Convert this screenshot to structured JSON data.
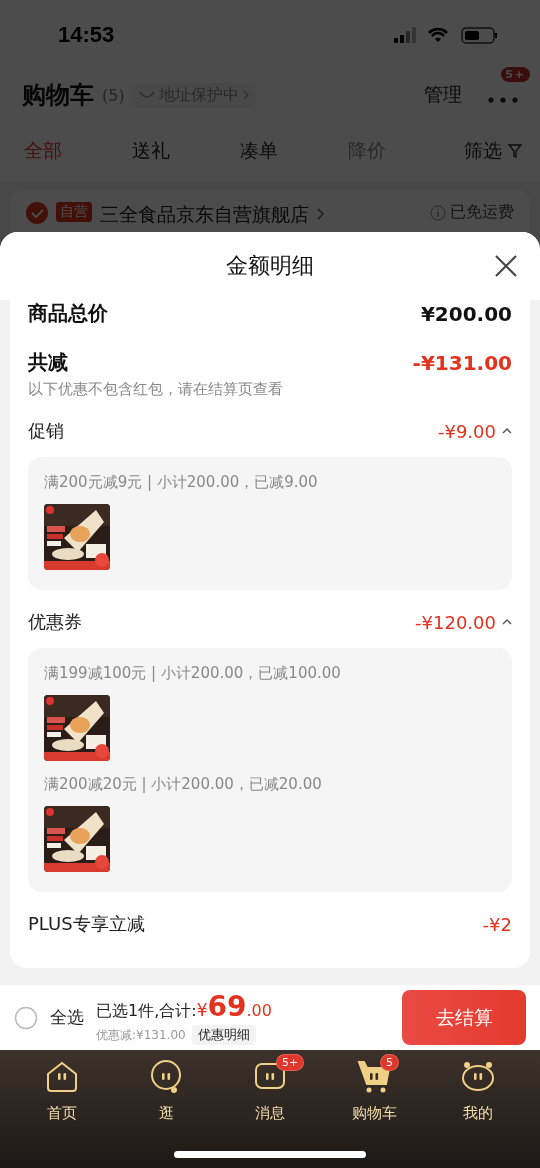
{
  "status_bar": {
    "time": "14:53"
  },
  "cart_page": {
    "title": "购物车",
    "count": "(5)",
    "address": "地址保护中",
    "manage": "管理",
    "more_badge": "5+",
    "tabs": [
      {
        "label": "全部",
        "selected": true,
        "disabled": false
      },
      {
        "label": "送礼",
        "selected": false,
        "disabled": false
      },
      {
        "label": "凑单",
        "selected": false,
        "disabled": false
      },
      {
        "label": "降价",
        "selected": false,
        "disabled": true
      }
    ],
    "filter": "筛选",
    "store": {
      "checked": true,
      "tag": "自营",
      "name": "三全食品京东自营旗舰店",
      "shipping": "已免运费"
    }
  },
  "sheet": {
    "title": "金额明细",
    "total": {
      "label": "商品总价",
      "amount": "¥200.00"
    },
    "reduction": {
      "label": "共减",
      "amount": "-¥131.00",
      "note": "以下优惠不包含红包，请在结算页查看"
    },
    "groups": [
      {
        "name": "促销",
        "amount": "-¥9.00",
        "expanded": true,
        "entries": [
          {
            "rule": "满200元减9元 | 小计200.00，已减9.00",
            "kind": "picture"
          }
        ]
      },
      {
        "name": "优惠券",
        "amount": "-¥120.00",
        "expanded": true,
        "entries": [
          {
            "rule": "满199减100元 | 小计200.00，已减100.00",
            "kind": "picture"
          },
          {
            "rule": "满200减20元 | 小计200.00，已减20.00",
            "kind": "picture"
          }
        ]
      },
      {
        "name": "PLUS专享立减",
        "amount": "-¥2"
      }
    ]
  },
  "bottom_bar": {
    "select_all": {
      "label": "全选",
      "checked": false
    },
    "summary": "已选1件,合计:",
    "currency": "¥",
    "price_int": "69",
    "price_dec": ".00",
    "discount": "优惠减:¥131.00",
    "detail": "优惠明细",
    "checkout": "去结算"
  },
  "tab_bar": [
    {
      "label": "首页",
      "selected": false
    },
    {
      "label": "逛",
      "selected": false
    },
    {
      "label": "消息",
      "badge": "5+",
      "selected": false
    },
    {
      "label": "购物车",
      "badge": "5",
      "selected": true
    },
    {
      "label": "我的",
      "selected": false
    }
  ]
}
